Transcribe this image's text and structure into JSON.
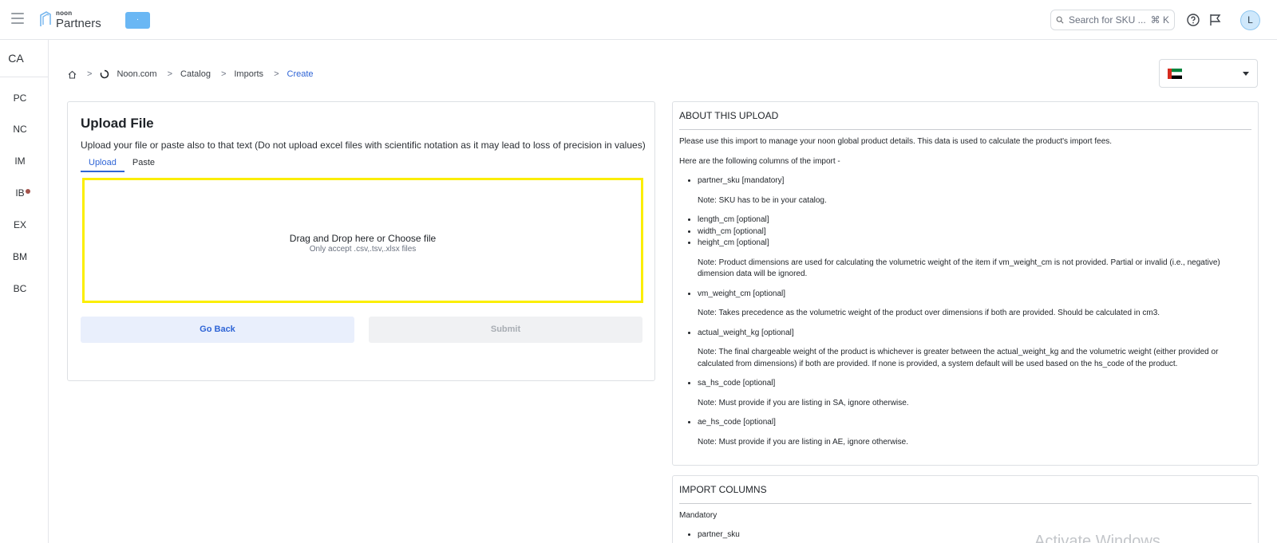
{
  "header": {
    "logo_small": "noon",
    "logo_big": "Partners",
    "env_label": "·",
    "search_placeholder": "Search for SKU ...",
    "search_shortcut": "⌘ K",
    "avatar_initial": "L"
  },
  "sidebar": {
    "top_label": "CA",
    "items": [
      {
        "label": "PC"
      },
      {
        "label": "NC"
      },
      {
        "label": "IM"
      },
      {
        "label": "IB",
        "has_dot": true
      },
      {
        "label": "EX"
      },
      {
        "label": "BM"
      },
      {
        "label": "BC"
      }
    ]
  },
  "breadcrumb": {
    "items": [
      "Noon.com",
      "Catalog",
      "Imports",
      "Create"
    ]
  },
  "country_select": {
    "flag": "ae-flag"
  },
  "upload": {
    "title": "Upload File",
    "description": "Upload your file or paste also to that text (Do not upload excel files with scientific notation as it may lead to loss of precision in values)",
    "tabs": [
      "Upload",
      "Paste"
    ],
    "active_tab": "Upload",
    "dropzone_title": "Drag and Drop here or Choose file",
    "dropzone_sub": "Only accept .csv,.tsv,.xlsx files",
    "back_label": "Go Back",
    "submit_label": "Submit"
  },
  "about": {
    "heading": "ABOUT THIS UPLOAD",
    "intro": "Please use this import to manage your noon global product details. This data is used to calculate the product's import fees.",
    "columns_intro": "Here are the following columns of the import -",
    "col_partner_sku": "partner_sku [mandatory]",
    "note_partner_sku": "Note: SKU has to be in your catalog.",
    "col_length": "length_cm [optional]",
    "col_width": "width_cm [optional]",
    "col_height": "height_cm [optional]",
    "note_dimensions": "Note: Product dimensions are used for calculating the volumetric weight of the item if vm_weight_cm is not provided. Partial or invalid (i.e., negative) dimension data will be ignored.",
    "col_vm_weight": "vm_weight_cm [optional]",
    "note_vm_weight": "Note: Takes precedence as the volumetric weight of the product over dimensions if both are provided. Should be calculated in cm3.",
    "col_actual_weight": "actual_weight_kg [optional]",
    "note_actual_weight": "Note: The final chargeable weight of the product is whichever is greater between the actual_weight_kg and the volumetric weight (either provided or calculated from dimensions) if both are provided. If none is provided, a system default will be used based on the hs_code of the product.",
    "col_sa_hs": "sa_hs_code [optional]",
    "note_sa_hs": "Note: Must provide if you are listing in SA, ignore otherwise.",
    "col_ae_hs": "ae_hs_code [optional]",
    "note_ae_hs": "Note: Must provide if you are listing in AE, ignore otherwise."
  },
  "import_columns": {
    "heading": "IMPORT COLUMNS",
    "mandatory_label": "Mandatory",
    "mandatory_items": [
      "partner_sku"
    ]
  },
  "watermark": "Activate Windows",
  "colors": {
    "accent": "#2f65d6",
    "dropzone_border": "#fbee00",
    "env_pill": "#6ab7f4"
  }
}
